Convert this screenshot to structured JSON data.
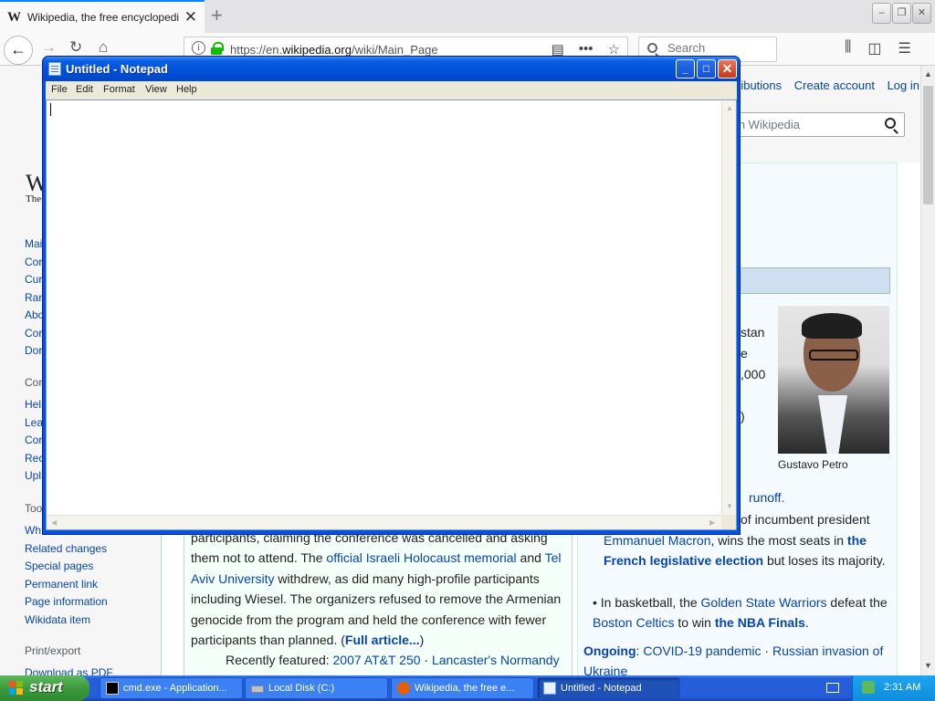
{
  "browser": {
    "tab_title": "Wikipedia, the free encyclopedia",
    "tab_logo": "W",
    "url_prefix": "https://en.",
    "url_domain": "wikipedia.org",
    "url_path": "/wiki/Main_Page",
    "search_placeholder": "Search",
    "icons": [
      "back-arrow-icon",
      "forward-arrow-icon",
      "reload-icon",
      "home-icon",
      "info-icon",
      "lock-icon",
      "reader-view-icon",
      "more-actions-icon",
      "bookmark-star-icon",
      "library-icon",
      "sidebar-icon",
      "hamburger-menu-icon"
    ]
  },
  "wikipedia": {
    "user_links": [
      "ributions",
      "Create account",
      "Log in"
    ],
    "search_placeholder": "rch Wikipedia",
    "logo_letter": "W",
    "logo_sub": "The",
    "sidebar_nav": [
      "Mai",
      "Cor",
      "Cur",
      "Ran",
      "Abo",
      "Cor",
      "Dor"
    ],
    "sidebar_contribute_head": "Cor",
    "sidebar_contribute": [
      "Hel",
      "Lea",
      "Cor",
      "Rec",
      "Upl"
    ],
    "sidebar_tools_head": "Too",
    "sidebar_tools": [
      "Wh",
      "Related changes",
      "Special pages",
      "Permanent link",
      "Page information",
      "Wikidata item"
    ],
    "sidebar_print_head": "Print/export",
    "sidebar_print": [
      "Download as PDF"
    ],
    "itn_fragments": [
      "stan",
      "e",
      ",000",
      ")"
    ],
    "itn_photo_caption": "Gustavo Petro",
    "itn_runoff_suffix": "runoff.",
    "itn_item_line1": "of incumbent president",
    "itn_macron": "Emmanuel Macron",
    "itn_macron_after": ", wins the most seats in ",
    "itn_french_election": "the French legislative election",
    "itn_macron_end": " but loses its majority.",
    "itn_nba_before": "In basketball, the ",
    "itn_warriors": "Golden State Warriors",
    "itn_nba_mid": " defeat the ",
    "itn_celtics": "Boston Celtics",
    "itn_nba_to": " to win ",
    "itn_finals": "the NBA Finals",
    "itn_nba_end": ".",
    "ongoing_label": "Ongoing",
    "ongoing_colon": ": ",
    "ongoing_covid": "COVID-19 pandemic",
    "ongoing_sep": " · ",
    "ongoing_ukraine": "Russian invasion of Ukraine",
    "tfa_lead": "participants, claiming the conference was cancelled and asking them not to attend. The ",
    "tfa_memorial": "official Israeli Holocaust memorial",
    "tfa_and": " and ",
    "tfa_tau": "Tel Aviv University",
    "tfa_mid": " withdrew, as did many high-profile participants including Wiesel. The organizers refused to remove the Armenian genocide from the program and held the conference with fewer participants than planned. (",
    "tfa_full": "Full article...",
    "tfa_close": ")",
    "recent_label": "Recently featured: ",
    "recent_1": "2007 AT&T 250",
    "recent_sep": " · ",
    "recent_2": "Lancaster's Normandy"
  },
  "notepad": {
    "title": "Untitled - Notepad",
    "menu": [
      "File",
      "Edit",
      "Format",
      "View",
      "Help"
    ],
    "content": ""
  },
  "taskbar": {
    "start_label": "start",
    "tasks": [
      "cmd.exe - Application...",
      "Local Disk (C:)",
      "Wikipedia, the free e...",
      "Untitled - Notepad"
    ],
    "clock": "2:31 AM"
  }
}
